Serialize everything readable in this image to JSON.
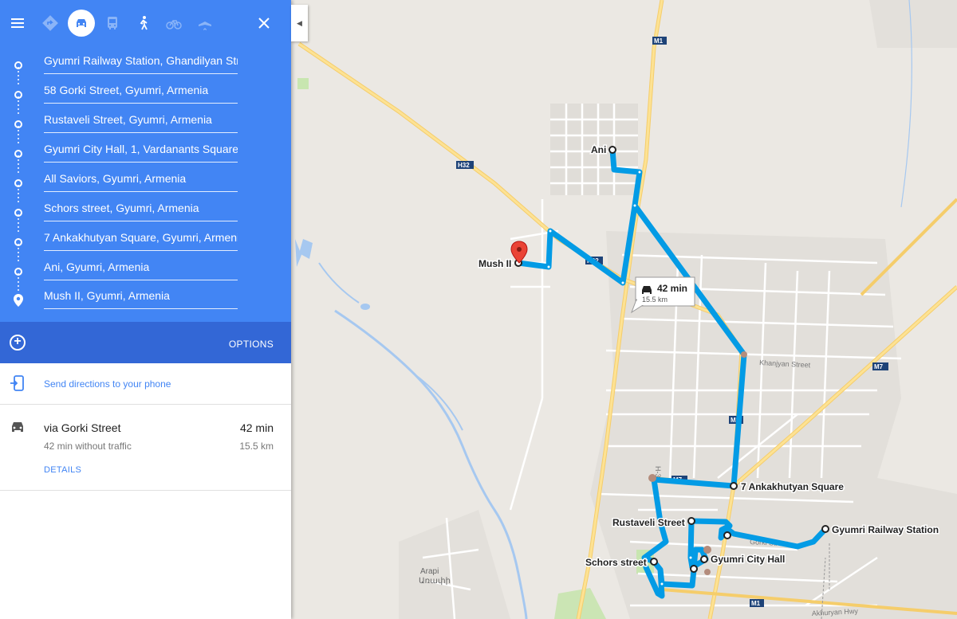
{
  "travel_modes": [
    {
      "name": "best-route",
      "selected": false
    },
    {
      "name": "driving",
      "selected": true
    },
    {
      "name": "transit",
      "selected": false
    },
    {
      "name": "walking",
      "selected": false
    },
    {
      "name": "cycling",
      "selected": false
    },
    {
      "name": "flights",
      "selected": false
    }
  ],
  "stops": [
    "Gyumri Railway Station, Ghandilyan Str",
    "58 Gorki Street, Gyumri, Armenia",
    "Rustaveli Street, Gyumri, Armenia",
    "Gyumri City Hall, 1, Vardanants Square,",
    "All Saviors, Gyumri, Armenia",
    "Schors street, Gyumri, Armenia",
    "7 Ankakhutyan Square, Gyumri, Armeni",
    "Ani, Gyumri, Armenia",
    "Mush II, Gyumri, Armenia"
  ],
  "options_label": "OPTIONS",
  "send_label": "Send directions to your phone",
  "route": {
    "via": "via Gorki Street",
    "duration": "42 min",
    "traffic_note": "42 min without traffic",
    "distance": "15.5 km",
    "details_label": "DETAILS"
  },
  "map": {
    "callout_time": "42 min",
    "callout_dist": "15.5 km",
    "place_labels": {
      "ani": "Ani",
      "mush": "Mush II",
      "ankakhutyan": "7 Ankakhutyan Square",
      "rustaveli": "Rustaveli Street",
      "railway": "Gyumri Railway Station",
      "cityhall": "Gyumri City Hall",
      "schors": "Schors street",
      "arapi": "Arapi",
      "arapi_local": "Առափի"
    },
    "road_labels": {
      "m1_top": "M1",
      "m1_mid": "M1",
      "m1_bottom": "M1",
      "m7_right": "M7",
      "m7_mid": "M7",
      "h32_left": "H32",
      "h32_mid": "H32",
      "h32_vertical": "H-32",
      "khanjyan": "Khanjyan Street",
      "gorki": "Gorki Street",
      "akhuryan": "Akhuryan Hwy"
    },
    "route_color": "#039be5",
    "accent": "#4285f4"
  }
}
